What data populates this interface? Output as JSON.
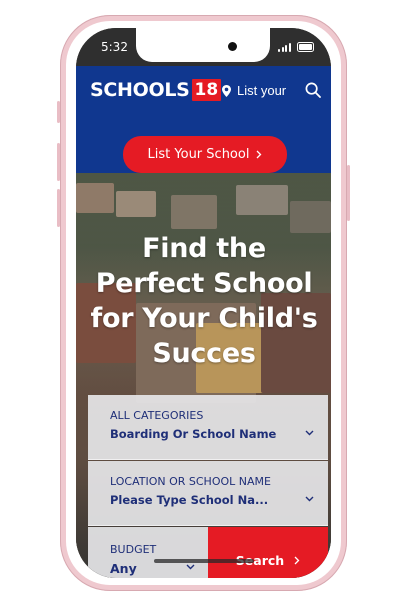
{
  "status_bar": {
    "time": "5:32"
  },
  "header": {
    "logo_text": "SCHOOLS",
    "logo_number": "18",
    "list_link_label": "List your",
    "cta_label": "List Your School",
    "icons": [
      "location-pin-icon",
      "search-icon",
      "chevron-right-icon"
    ]
  },
  "hero": {
    "title": "Find the Perfect School for Your Child's Succes"
  },
  "search_form": {
    "category": {
      "label": "ALL CATEGORIES",
      "value": "Boarding Or School Name"
    },
    "location": {
      "label": "LOCATION OR SCHOOL NAME",
      "value": "Please Type School Na..."
    },
    "budget": {
      "label": "BUDGET",
      "value": "Any"
    },
    "submit_label": "Search"
  },
  "colors": {
    "brand_blue": "#10378f",
    "accent_red": "#e51b24",
    "frame_pink": "#efc9cf",
    "field_text": "#1f2f78"
  }
}
